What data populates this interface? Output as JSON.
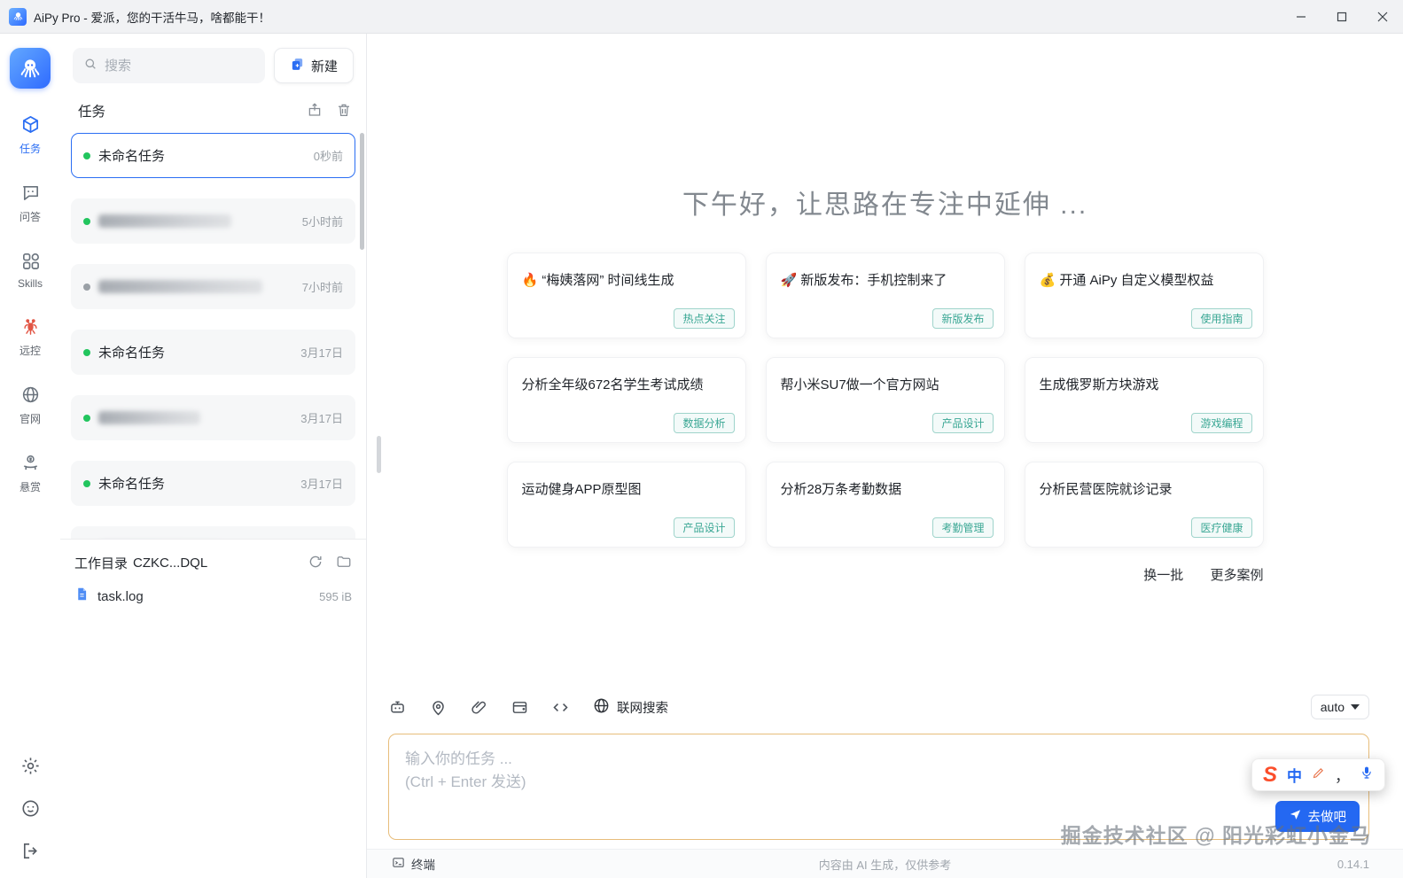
{
  "window": {
    "title": "AiPy Pro - 爱派，您的干活牛马，啥都能干！"
  },
  "sidebar": {
    "items": [
      {
        "label": "任务",
        "active": true
      },
      {
        "label": "问答",
        "active": false
      },
      {
        "label": "Skills",
        "active": false
      },
      {
        "label": "远控",
        "active": false
      },
      {
        "label": "官网",
        "active": false
      },
      {
        "label": "悬赏",
        "active": false
      }
    ]
  },
  "tasks_panel": {
    "search_placeholder": "搜索",
    "new_button": "新建",
    "header": "任务",
    "tasks": [
      {
        "name": "未命名任务",
        "time": "0秒前",
        "selected": true,
        "blurred": false,
        "dot": "green"
      },
      {
        "name": "",
        "time": "5小时前",
        "selected": false,
        "blurred": true,
        "dot": "green"
      },
      {
        "name": "",
        "time": "7小时前",
        "selected": false,
        "blurred": true,
        "dot": "gray"
      },
      {
        "name": "未命名任务",
        "time": "3月17日",
        "selected": false,
        "blurred": false,
        "dot": "green"
      },
      {
        "name": "",
        "time": "3月17日",
        "selected": false,
        "blurred": true,
        "dot": "green"
      },
      {
        "name": "未命名任务",
        "time": "3月17日",
        "selected": false,
        "blurred": false,
        "dot": "green"
      }
    ],
    "workdir": {
      "label": "工作目录",
      "path": "CZKC...DQL",
      "file_name": "task.log",
      "file_size": "595 iB"
    }
  },
  "main": {
    "greeting": "下午好，让思路在专注中延伸 ...",
    "cards": [
      {
        "title": "🔥 “梅姨落网” 时间线生成",
        "tag": "热点关注"
      },
      {
        "title": "🚀 新版发布：手机控制来了",
        "tag": "新版发布"
      },
      {
        "title": "💰 开通 AiPy 自定义模型权益",
        "tag": "使用指南"
      },
      {
        "title": "分析全年级672名学生考试成绩",
        "tag": "数据分析"
      },
      {
        "title": "帮小米SU7做一个官方网站",
        "tag": "产品设计"
      },
      {
        "title": "生成俄罗斯方块游戏",
        "tag": "游戏编程"
      },
      {
        "title": "运动健身APP原型图",
        "tag": "产品设计"
      },
      {
        "title": "分析28万条考勤数据",
        "tag": "考勤管理"
      },
      {
        "title": "分析民营医院就诊记录",
        "tag": "医疗健康"
      }
    ],
    "links": {
      "refresh": "换一批",
      "more": "更多案例"
    },
    "toolbar": {
      "web_search": "联网搜索",
      "model": "auto"
    },
    "input": {
      "placeholder_line1": "输入你的任务 ...",
      "placeholder_line2": "(Ctrl + Enter 发送)"
    },
    "send_button": "去做吧",
    "ime": {
      "logo": "S",
      "lang": "中",
      "punct": "，"
    },
    "watermark": "掘金技术社区 @ 阳光彩虹小金马"
  },
  "statusbar": {
    "terminal": "终端",
    "notice": "内容由 AI 生成，仅供参考",
    "version": "0.14.1"
  },
  "colors": {
    "accent": "#2b6ef3",
    "tag": "#3aa794",
    "input_border": "#e7bd7b",
    "dot_green": "#22c55e",
    "dot_gray": "#9aa0a6",
    "sogou_red": "#fb4e2b"
  },
  "icons": {
    "app-logo": "octopus",
    "search": "magnifier",
    "new-task": "blue-pages-plus",
    "export": "box-arrow-up",
    "trash": "trash-can",
    "refresh": "circular-arrow",
    "folder": "folder-outline",
    "log-file": "blue-document",
    "nav-tasks": "cube",
    "nav-qa": "speech-bubble",
    "nav-skills": "grid",
    "nav-remote": "lobster",
    "nav-website": "globe",
    "nav-bounty": "hand-coin",
    "settings": "gear",
    "account": "smiley",
    "logout": "door-arrow",
    "robot": "robot-head",
    "location": "map-pin",
    "attach": "paperclip",
    "template": "card-plus",
    "code": "angle-brackets",
    "web-search": "globe",
    "send": "paper-plane",
    "terminal": "terminal-window",
    "mic": "microphone",
    "pen": "pen",
    "minimize": "–",
    "maximize": "▢",
    "close": "✕"
  }
}
